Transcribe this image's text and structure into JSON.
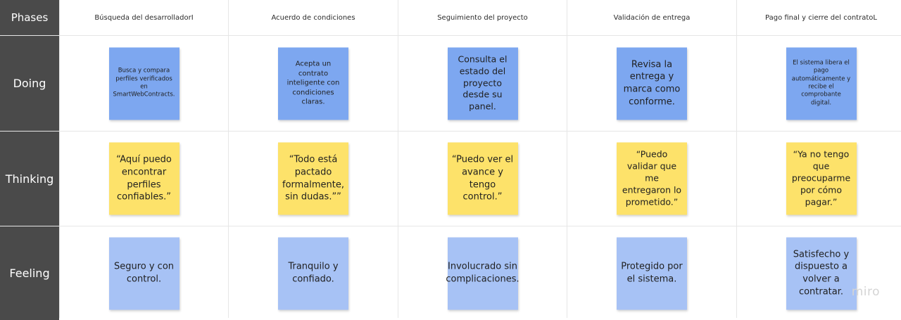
{
  "board": {
    "phases_label": "Phases",
    "columns": [
      "Búsqueda del desarrolladorI",
      "Acuerdo de condiciones",
      "Seguimiento del proyecto",
      "Validación de entrega",
      "Pago final y cierre del contratoL"
    ],
    "rows": [
      {
        "label": "Doing",
        "notes": [
          "Busca y compara perfiles verificados en SmartWebContracts.",
          "Acepta un contrato inteligente con condiciones claras.",
          "Consulta el estado del proyecto desde su panel.",
          "Revisa la entrega y marca como conforme.",
          "El sistema libera el pago automáticamente y recibe el comprobante digital."
        ]
      },
      {
        "label": "Thinking",
        "notes": [
          "“Aquí puedo encontrar perfiles confiables.”",
          "“Todo está pactado formalmente, sin dudas.””",
          "“Puedo ver el avance y tengo control.”",
          "“Puedo validar que me entregaron lo prometido.”",
          "“Ya no tengo que preocuparme por cómo pagar.”"
        ]
      },
      {
        "label": "Feeling",
        "notes": [
          "Seguro y con control.",
          "Tranquilo y confiado.",
          "Involucrado sin complicaciones.",
          "Protegido por el sistema.",
          "Satisfecho y dispuesto a volver a contratar."
        ]
      }
    ]
  },
  "watermark": "miro",
  "colors": {
    "doing_note": "#7da7f0",
    "thinking_note": "#fde26a",
    "feeling_note": "#a7c2f5",
    "row_header": "#4a4a4a"
  }
}
